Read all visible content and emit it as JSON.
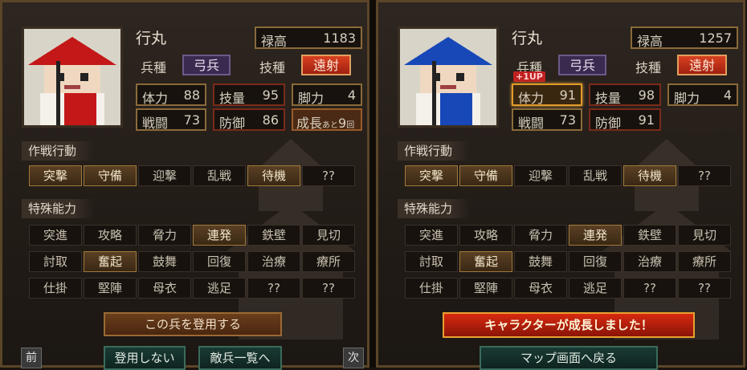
{
  "left": {
    "name": "行丸",
    "unit_type_label": "兵種",
    "unit_type": "弓兵",
    "skill_type_label": "技種",
    "skill_type": "遠射",
    "stipend_label": "禄高",
    "stipend": "1183",
    "stats": [
      {
        "label": "体力",
        "value": "88"
      },
      {
        "label": "技量",
        "value": "95"
      },
      {
        "label": "脚力",
        "value": "4"
      },
      {
        "label": "戦闘",
        "value": "73"
      },
      {
        "label": "防御",
        "value": "86"
      }
    ],
    "growth_label": "成長あと9回",
    "growth_main": "成長",
    "growth_small": "あと",
    "growth_num": "9",
    "growth_unit": "回",
    "tactics_title": "作戦行動",
    "tactics": [
      "突撃",
      "守備",
      "迎撃",
      "乱戦",
      "待機",
      "??"
    ],
    "abilities_title": "特殊能力",
    "abilities": [
      "突進",
      "攻略",
      "脅力",
      "連発",
      "鉄壁",
      "見切",
      "討取",
      "奮起",
      "鼓舞",
      "回復",
      "治療",
      "療所",
      "仕掛",
      "堅陣",
      "母衣",
      "逃足",
      "??",
      "??"
    ],
    "recruit_label": "この兵を登用する",
    "prev_label": "前",
    "decline_label": "登用しない",
    "enemy_list_label": "敵兵一覧へ",
    "next_label": "次",
    "hat_color": "#c41818"
  },
  "right": {
    "name": "行丸",
    "unit_type_label": "兵種",
    "unit_type": "弓兵",
    "skill_type_label": "技種",
    "skill_type": "遠射",
    "stipend_label": "禄高",
    "stipend": "1257",
    "levelup_label": "+1UP",
    "stats": [
      {
        "label": "体力",
        "value": "91"
      },
      {
        "label": "技量",
        "value": "98"
      },
      {
        "label": "脚力",
        "value": "4"
      },
      {
        "label": "戦闘",
        "value": "73"
      },
      {
        "label": "防御",
        "value": "91"
      }
    ],
    "tactics_title": "作戦行動",
    "tactics": [
      "突撃",
      "守備",
      "迎撃",
      "乱戦",
      "待機",
      "??"
    ],
    "abilities_title": "特殊能力",
    "abilities": [
      "突進",
      "攻略",
      "脅力",
      "連発",
      "鉄壁",
      "見切",
      "討取",
      "奮起",
      "鼓舞",
      "回復",
      "治療",
      "療所",
      "仕掛",
      "堅陣",
      "母衣",
      "逃足",
      "??",
      "??"
    ],
    "grown_message": "キャラクターが成長しました！",
    "map_return_label": "マップ画面へ戻る",
    "hat_color": "#1848b8"
  },
  "active_tactics": [
    "突撃",
    "守備",
    "待機"
  ],
  "active_abilities": [
    "連発",
    "奮起"
  ]
}
